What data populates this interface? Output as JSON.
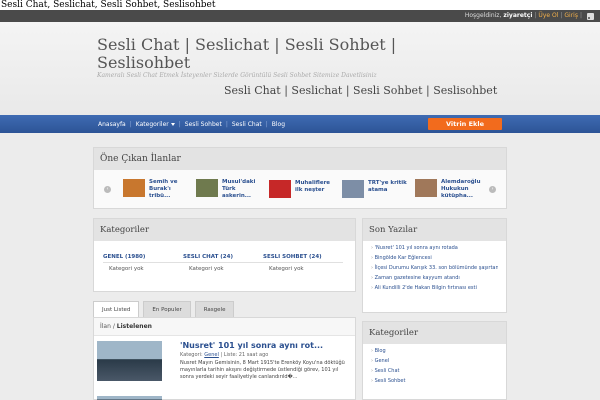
{
  "document_title": "Sesli Chat, Seslichat, Sesli Sohbet, Seslisohbet",
  "topbar": {
    "greeting": "Hoşgeldiniz,",
    "username": "ziyaretçi",
    "sep1": "|",
    "register": "Üye Ol",
    "sep2": "|",
    "login": "Giriş",
    "sep3": "|"
  },
  "header": {
    "title": "Sesli Chat | Seslichat | Sesli Sohbet | Seslisohbet",
    "description": "Kameralı Sesli Chat Etmek İsteyenler Sizlerde Görüntülü Sesli Sohbet Sitemize Davetlisiniz",
    "banner": "Sesli Chat | Seslichat | Sesli Sohbet | Seslisohbet"
  },
  "nav": {
    "items": [
      "Anasayfa",
      "Kategoriler",
      "Sesli Sohbet",
      "Sesli Chat",
      "Blog"
    ],
    "separator": "|",
    "cta": "Vitrin Ekle"
  },
  "featured": {
    "title": "Öne Çıkan İlanlar",
    "prev": "‹",
    "next": "›",
    "items": [
      {
        "title": "Semih ve Burak'ı tribü...",
        "color": "#c8772e"
      },
      {
        "title": "Musul'daki Türk askerin...",
        "color": "#6f7a4e"
      },
      {
        "title": "Muhaliflere ilk neşter",
        "color": "#c62828"
      },
      {
        "title": "TRT'ye kritik atama",
        "color": "#7d8ea6"
      },
      {
        "title": "Alemdaroğlu Hukukun kütüpha...",
        "color": "#a0785a"
      }
    ]
  },
  "categories": {
    "title": "Kategoriler",
    "items": [
      {
        "name": "GENEL (1980)",
        "empty": "Kategori yok"
      },
      {
        "name": "SESLI CHAT (24)",
        "empty": "Kategori yok"
      },
      {
        "name": "SESLI SOHBET (24)",
        "empty": "Kategori yok"
      }
    ]
  },
  "recent": {
    "title": "Son Yazılar",
    "items": [
      "'Nusret' 101 yıl sonra aynı rotada",
      "Bingölde Kar Eğlencesi",
      "İlçesi Durumu Karışık 33. son bölümünde şaşırtan sahne",
      "Zaman gazetesine kayyum atandı",
      "Ali Kundilli 2'de Hakan Bilgin fırtınası esti"
    ]
  },
  "sidebar_categories": {
    "title": "Kategoriler",
    "items": [
      "Blog",
      "Genel",
      "Sesli Chat",
      "Sesli Sohbet"
    ]
  },
  "tabs": [
    "Just Listed",
    "En Populer",
    "Rasgele"
  ],
  "listing": {
    "crumb_prefix": "İlan /",
    "crumb_current": "Listelenen",
    "post": {
      "title": "'Nusret' 101 yıl sonra aynı rot...",
      "meta_prefix": "Kategori:",
      "category": "Genel",
      "meta_suffix": "| Liste: 21 saat ago",
      "excerpt": "Nusret Mayın Gemisinin, 8 Mart 1915'te Erenköy Koyu'na döktüğü mayınlarla tarihin akışını değiştirmede üstlendiği görev, 101 yıl sonra yerdeki seyir faaliyetiyle canlandırıld�..."
    }
  }
}
